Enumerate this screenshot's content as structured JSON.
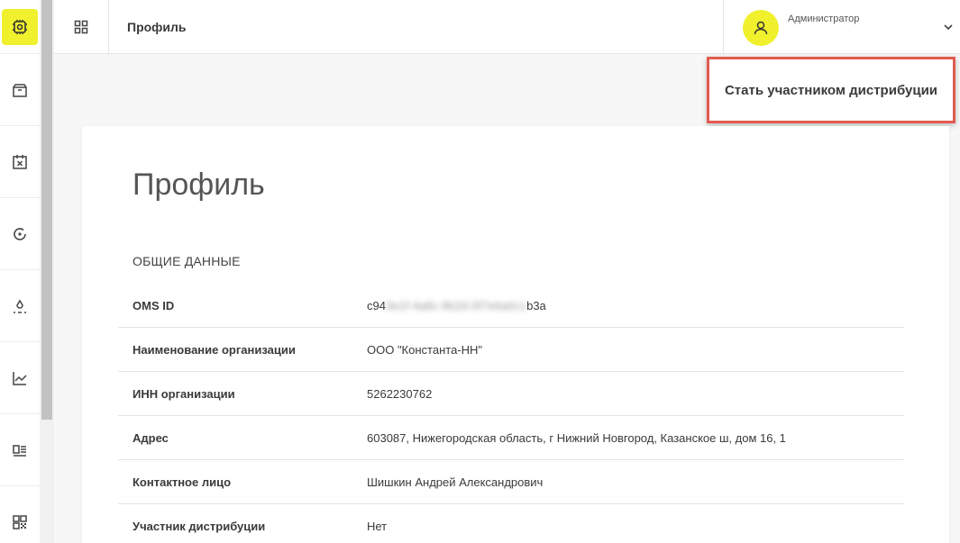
{
  "header": {
    "title": "Профиль",
    "user_name": "Администратор"
  },
  "actions": {
    "become_distributor": "Стать участником дистрибуции"
  },
  "sidebar": {
    "items": [
      {
        "icon": "chip-icon",
        "active": true
      },
      {
        "icon": "box-icon",
        "active": false
      },
      {
        "icon": "calendar-cross-icon",
        "active": false
      },
      {
        "icon": "refresh-circle-icon",
        "active": false
      },
      {
        "icon": "drop-icon",
        "active": false
      },
      {
        "icon": "trend-chart-icon",
        "active": false
      },
      {
        "icon": "list-card-icon",
        "active": false
      },
      {
        "icon": "qr-code-icon",
        "active": false
      }
    ]
  },
  "profile": {
    "heading": "Профиль",
    "section": "ОБЩИЕ ДАННЫЕ",
    "oms_id_start": "c94",
    "oms_id_hidden": "3e1f-4a8c-9b2d-5f7e6a0c1",
    "oms_id_end": "b3a",
    "rows": [
      {
        "label": "OMS ID"
      },
      {
        "label": "Наименование организации",
        "value": "ООО \"Константа-НН\""
      },
      {
        "label": "ИНН организации",
        "value": "5262230762"
      },
      {
        "label": "Адрес",
        "value": "603087, Нижегородская область, г Нижний Новгород, Казанское ш, дом 16, 1"
      },
      {
        "label": "Контактное лицо",
        "value": "Шишкин Андрей Александрович"
      },
      {
        "label": "Участник дистрибуции",
        "value": "Нет"
      }
    ]
  },
  "colors": {
    "accent": "#f0f02d",
    "highlight_border": "#e25b50"
  }
}
